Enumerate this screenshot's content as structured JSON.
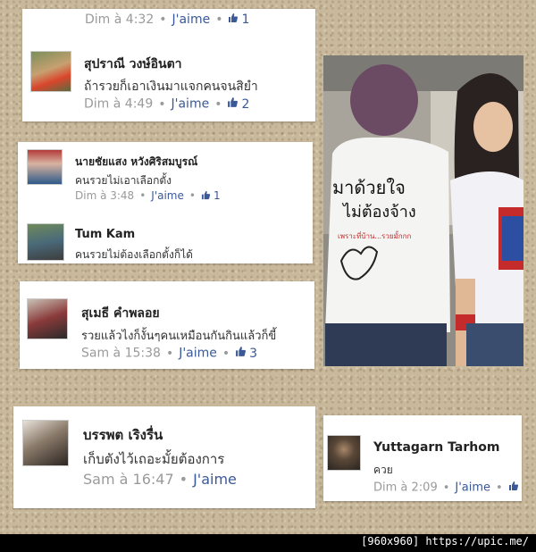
{
  "comments": [
    {
      "top_meta_time": "Dim à 4:32",
      "top_meta_like": "J'aime",
      "top_meta_count": "1"
    },
    {
      "name": "สุปราณี วงษ์อินตา",
      "text": "ถ้ารวยก็เอาเงินมาแจกคนจนสิยำ",
      "time": "Dim à 4:49",
      "like": "J'aime",
      "count": "2"
    },
    {
      "name": "นายชัยแสง หวังศิริสมบูรณ์",
      "text": "คนรวยไม่เอาเลือกตั้ง",
      "time": "Dim à 3:48",
      "like": "J'aime",
      "count": "1"
    },
    {
      "name": "Tum Kam",
      "text": "คนรวยไม่ต้องเลือกตั้งก็ได้"
    },
    {
      "name": "สุเมธี คำพลอย",
      "text": "รวยแล้วไงก็งั้นๆคนเหมือนกันกินแล้วก็ขี้",
      "time": "Sam à 15:38",
      "like": "J'aime",
      "count": "3"
    },
    {
      "name": "บรรพต เริงรื่น",
      "text": "เก็บตังไว้เถอะมั้ยต้องการ",
      "time": "Sam à 16:47",
      "like": "J'aime"
    },
    {
      "name": "Yuttagarn Tarhom",
      "text": "ควย",
      "time": "Dim à 2:09",
      "like": "J'aime"
    }
  ],
  "photo": {
    "shirt_line1": "มาด้วยใจ",
    "shirt_line2": "ไม่ต้องจ้าง",
    "shirt_line3": "เพราะที่บ้าน...รวยมั้กกก"
  },
  "footer": {
    "text": "[960x960] https://upic.me/"
  },
  "colors": {
    "like_blue": "#3b5998",
    "meta_gray": "#9a9a9a",
    "board": "#c9b99c"
  }
}
